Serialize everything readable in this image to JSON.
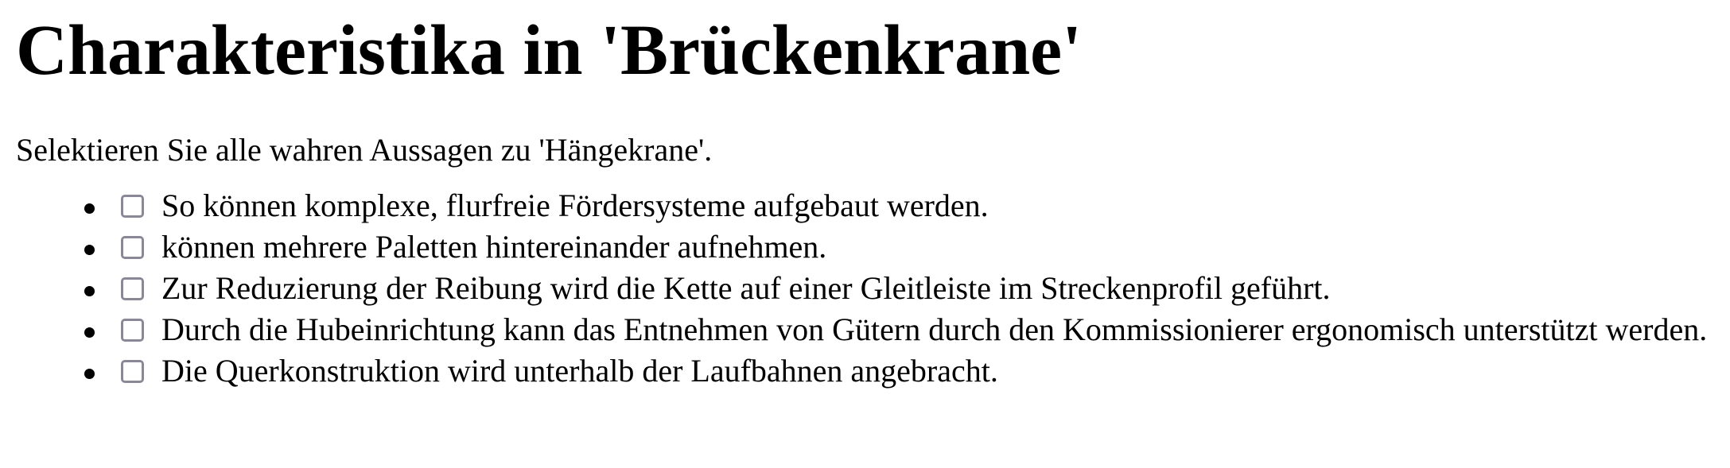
{
  "title": "Charakteristika in 'Brückenkrane'",
  "prompt": "Selektieren Sie alle wahren Aussagen zu 'Hängekrane'.",
  "options": [
    {
      "label": "So können komplexe, flurfreie Fördersysteme aufgebaut werden.",
      "checked": false
    },
    {
      "label": "können mehrere Paletten hintereinander aufnehmen.",
      "checked": false
    },
    {
      "label": "Zur Reduzierung der Reibung wird die Kette auf einer Gleitleiste im Streckenprofil geführt.",
      "checked": false
    },
    {
      "label": "Durch die Hubeinrichtung kann das Entnehmen von Gütern durch den Kommissionierer ergonomisch unterstützt werden.",
      "checked": false
    },
    {
      "label": "Die Querkonstruktion wird unterhalb der Laufbahnen angebracht.",
      "checked": false
    }
  ],
  "colors": {
    "checkbox_border": "#8a8896",
    "text": "#000000",
    "background": "#ffffff"
  }
}
